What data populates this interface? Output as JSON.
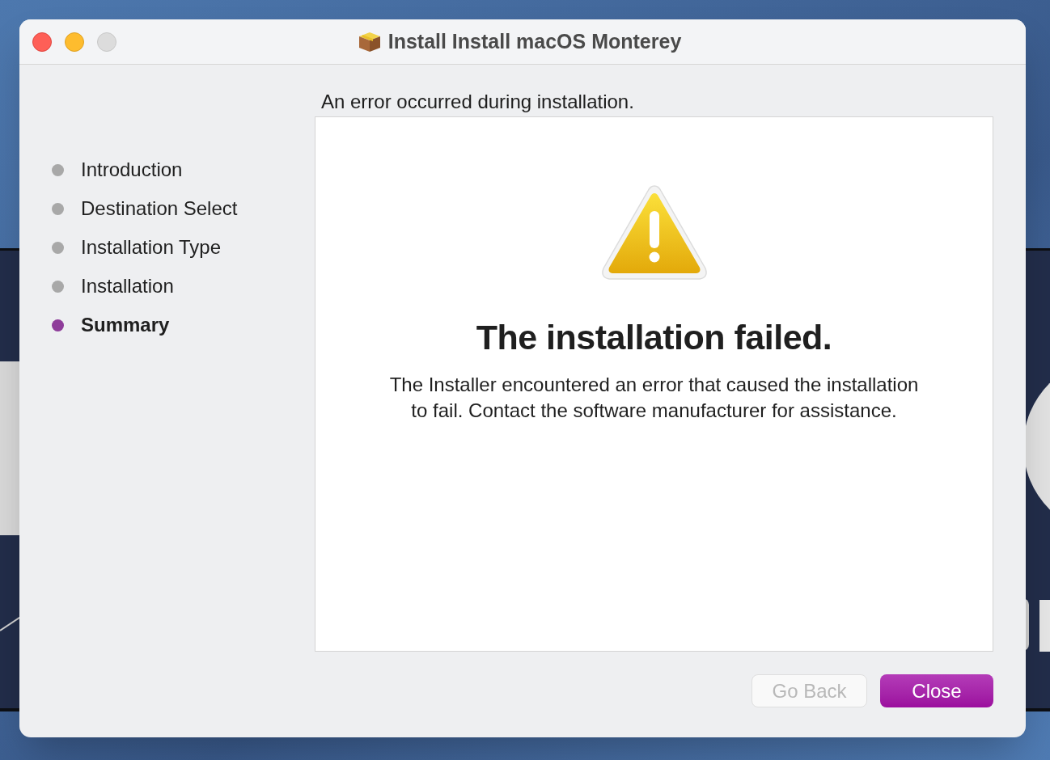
{
  "window": {
    "title": "Install Install macOS Monterey"
  },
  "steps": [
    {
      "label": "Introduction",
      "selected": false
    },
    {
      "label": "Destination Select",
      "selected": false
    },
    {
      "label": "Installation Type",
      "selected": false
    },
    {
      "label": "Installation",
      "selected": false
    },
    {
      "label": "Summary",
      "selected": true
    }
  ],
  "header": "An error occurred during installation.",
  "message": {
    "title": "The installation failed.",
    "body": "The Installer encountered an error that caused the installation to fail. Contact the software manufacturer for assistance."
  },
  "buttons": [
    {
      "label": "Go Back",
      "disabled": true,
      "default": false
    },
    {
      "label": "Close",
      "disabled": false,
      "default": true
    }
  ]
}
